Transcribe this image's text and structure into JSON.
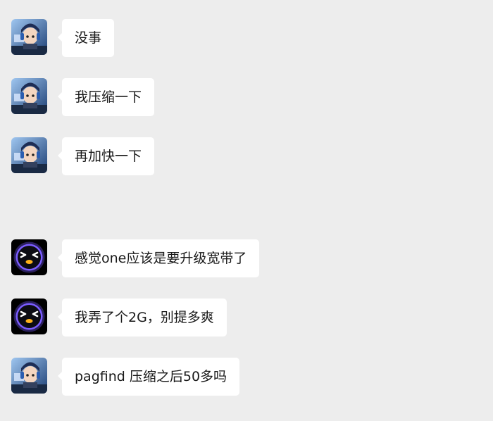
{
  "messages": [
    {
      "sender": "gamer",
      "text": "没事"
    },
    {
      "sender": "gamer",
      "text": "我压缩一下"
    },
    {
      "sender": "gamer",
      "text": "再加快一下"
    },
    {
      "sender": "robot",
      "text": "感觉one应该是要升级宽带了"
    },
    {
      "sender": "robot",
      "text": "我弄了个2G，别提多爽"
    },
    {
      "sender": "gamer",
      "text": "pagfind 压缩之后50多吗"
    }
  ],
  "avatars": {
    "gamer": {
      "icon": "gamer-avatar-icon",
      "accent": "#2f6fc0"
    },
    "robot": {
      "icon": "robot-avatar-icon",
      "accent": "#7a5cff"
    }
  },
  "colors": {
    "background": "#ededed",
    "bubble": "#ffffff",
    "text": "#191919"
  }
}
